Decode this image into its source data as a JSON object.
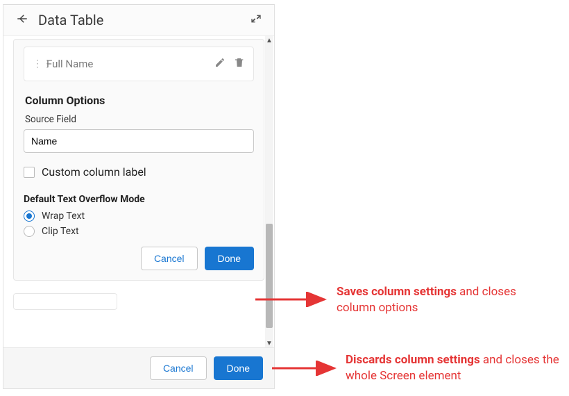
{
  "header": {
    "title": "Data Table"
  },
  "column_chip": {
    "name": "Full Name"
  },
  "options": {
    "heading": "Column Options",
    "source_field_label": "Source Field",
    "source_field_value": "Name",
    "checkbox_label": "Custom column label",
    "overflow_heading": "Default Text Overflow Mode",
    "radio_wrap": "Wrap Text",
    "radio_clip": "Clip Text",
    "cancel": "Cancel",
    "done": "Done"
  },
  "footer": {
    "cancel": "Cancel",
    "done": "Done"
  },
  "annotations": {
    "top_bold": "Saves column settings",
    "top_rest": " and closes column options",
    "bottom_bold": "Discards column settings",
    "bottom_rest": " and closes the whole Screen element"
  }
}
